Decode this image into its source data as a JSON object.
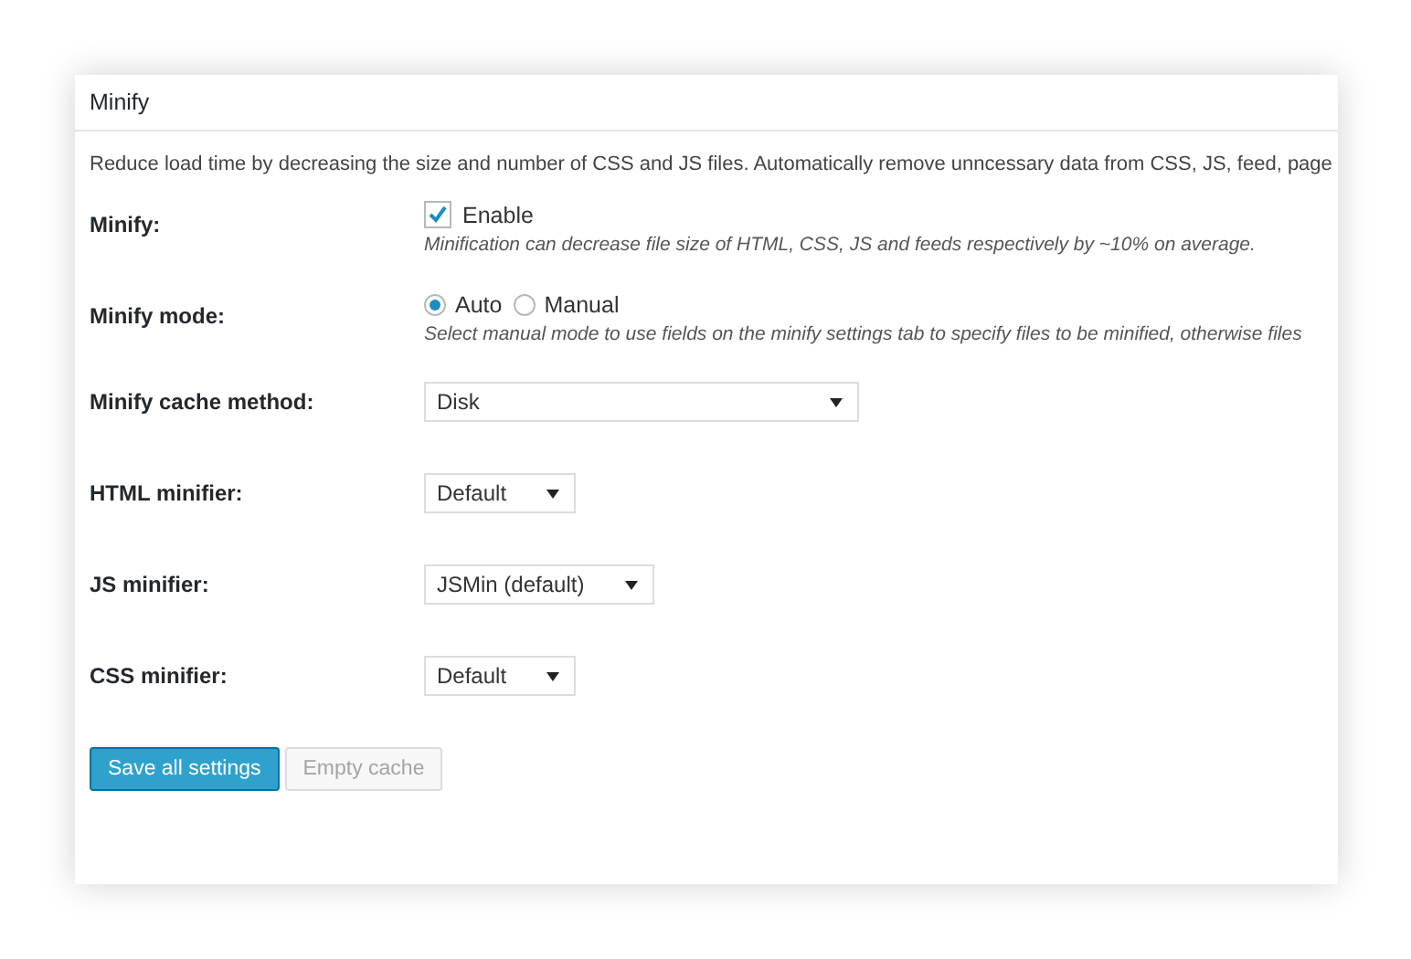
{
  "panel": {
    "title": "Minify",
    "description": "Reduce load time by decreasing the size and number of CSS and JS files. Automatically remove unncessary data from CSS, JS, feed, page",
    "settings": [
      {
        "kind": "checkbox",
        "label": "Minify:",
        "option": "Enable",
        "checked": true,
        "hint": "Minification can decrease file size of HTML, CSS, JS and feeds respectively by ~10% on average."
      },
      {
        "kind": "radio",
        "label": "Minify mode:",
        "options": [
          {
            "label": "Auto",
            "selected": true
          },
          {
            "label": "Manual",
            "selected": false
          }
        ],
        "hint": "Select manual mode to use fields on the minify settings tab to specify files to be minified, otherwise files"
      },
      {
        "kind": "select",
        "label": "Minify cache method:",
        "value": "Disk",
        "wide": true
      },
      {
        "kind": "select",
        "label": "HTML minifier:",
        "value": "Default",
        "wide": false
      },
      {
        "kind": "select",
        "label": "JS minifier:",
        "value": "JSMin (default)",
        "wide": false
      },
      {
        "kind": "select",
        "label": "CSS minifier:",
        "value": "Default",
        "wide": false
      }
    ],
    "buttons": [
      {
        "label": "Save all settings",
        "kind": "primary",
        "disabled": false
      },
      {
        "label": "Empty cache",
        "kind": "secondary",
        "disabled": true
      }
    ]
  }
}
